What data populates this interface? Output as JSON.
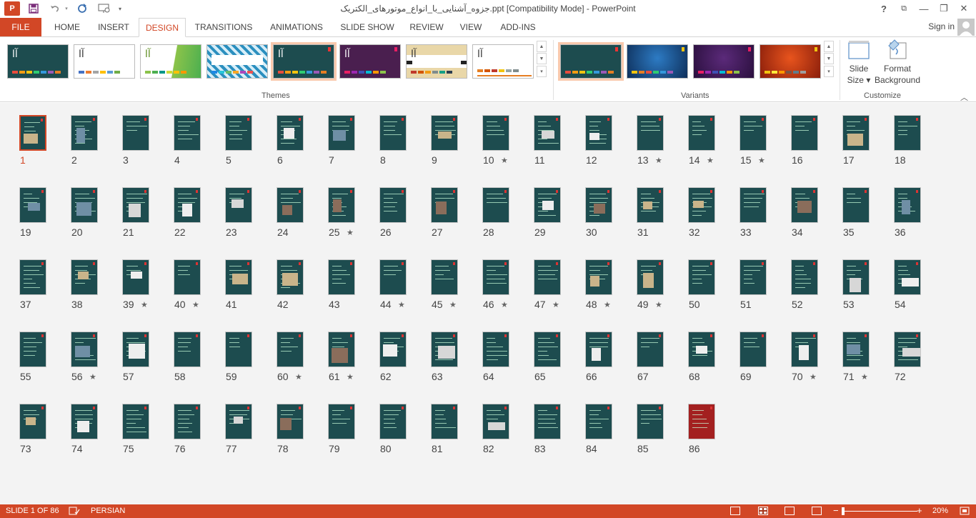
{
  "window": {
    "title": "جزوه_آشنایی_با_انواع_موتورهای_الکتریک.ppt [Compatibility Mode] - PowerPoint",
    "logo": "P",
    "help": "?",
    "restore_ribbon": "⧉",
    "minimize": "—",
    "maximize": "❐",
    "close": "✕"
  },
  "qat": {
    "save_icon": "floppy-disk",
    "undo_icon": "undo-arrow",
    "redo_icon": "redo-arrow",
    "present_icon": "start-from-beginning",
    "customize_icon": "dropdown-arrow"
  },
  "tabs": {
    "file": "FILE",
    "home": "HOME",
    "insert": "INSERT",
    "design": "DESIGN",
    "transitions": "TRANSITIONS",
    "animations": "ANIMATIONS",
    "slide_show": "SLIDE SHOW",
    "review": "REVIEW",
    "view": "VIEW",
    "add_ins": "ADD-INS",
    "active": "DESIGN"
  },
  "account": {
    "sign_in": "Sign in"
  },
  "ribbon": {
    "themes_label": "Themes",
    "variants_label": "Variants",
    "customize_label": "Customize",
    "theme_glyph": "آا",
    "slide_size": {
      "line1": "Slide",
      "line2": "Size"
    },
    "format_background": {
      "line1": "Format",
      "line2": "Background"
    }
  },
  "status": {
    "slide_info": "SLIDE 1 OF 86",
    "language": "PERSIAN",
    "zoom": "20%",
    "zoom_minus": "−",
    "zoom_plus": "+"
  },
  "slides": {
    "selected": 1,
    "total": 86,
    "starred": [
      10,
      13,
      14,
      15,
      25,
      39,
      40,
      44,
      45,
      46,
      47,
      48,
      49,
      56,
      60,
      61,
      70,
      71
    ],
    "star_glyph": "★"
  },
  "colors": {
    "accent": "#d24726",
    "slide_bg": "#1d4c4f"
  }
}
